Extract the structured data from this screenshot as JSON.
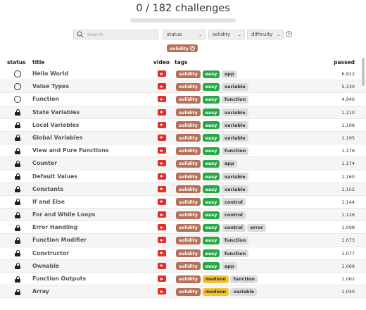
{
  "header": {
    "progress_text": "0 / 182 challenges",
    "progress_fraction": 0
  },
  "filters": {
    "search_placeholder": "Search",
    "status_label": "status",
    "solidity_label": "solidity",
    "difficulty_label": "difficulty",
    "active_filter": "solidity"
  },
  "table": {
    "columns": {
      "status": "status",
      "title": "title",
      "video": "video",
      "tags": "tags",
      "passed": "passed"
    },
    "rows": [
      {
        "status": "circle-icon",
        "title": "Hello World",
        "tags": [
          "solidity",
          "easy",
          "app"
        ],
        "passed": "6,912"
      },
      {
        "status": "circle-icon",
        "title": "Value Types",
        "tags": [
          "solidity",
          "easy",
          "variable"
        ],
        "passed": "5,330"
      },
      {
        "status": "circle-icon",
        "title": "Function",
        "tags": [
          "solidity",
          "easy",
          "function"
        ],
        "passed": "4,946"
      },
      {
        "status": "lock-icon",
        "title": "State Variables",
        "tags": [
          "solidity",
          "easy",
          "variable"
        ],
        "passed": "1,210"
      },
      {
        "status": "lock-icon",
        "title": "Local Variables",
        "tags": [
          "solidity",
          "easy",
          "variable"
        ],
        "passed": "1,198"
      },
      {
        "status": "lock-icon",
        "title": "Global Variables",
        "tags": [
          "solidity",
          "easy",
          "variable"
        ],
        "passed": "1,195"
      },
      {
        "status": "lock-icon",
        "title": "View and Pure Functions",
        "tags": [
          "solidity",
          "easy",
          "function"
        ],
        "passed": "1,176"
      },
      {
        "status": "lock-icon",
        "title": "Counter",
        "tags": [
          "solidity",
          "easy",
          "app"
        ],
        "passed": "1,174"
      },
      {
        "status": "lock-icon",
        "title": "Default Values",
        "tags": [
          "solidity",
          "easy",
          "variable"
        ],
        "passed": "1,160"
      },
      {
        "status": "lock-icon",
        "title": "Constants",
        "tags": [
          "solidity",
          "easy",
          "variable"
        ],
        "passed": "1,152"
      },
      {
        "status": "lock-icon",
        "title": "If and Else",
        "tags": [
          "solidity",
          "easy",
          "control"
        ],
        "passed": "1,144"
      },
      {
        "status": "lock-icon",
        "title": "For and While Loops",
        "tags": [
          "solidity",
          "easy",
          "control"
        ],
        "passed": "1,126"
      },
      {
        "status": "lock-icon",
        "title": "Error Handling",
        "tags": [
          "solidity",
          "easy",
          "control",
          "error"
        ],
        "passed": "1,098"
      },
      {
        "status": "lock-icon",
        "title": "Function Modifier",
        "tags": [
          "solidity",
          "easy",
          "function"
        ],
        "passed": "1,073"
      },
      {
        "status": "lock-icon",
        "title": "Constructor",
        "tags": [
          "solidity",
          "easy",
          "function"
        ],
        "passed": "1,077"
      },
      {
        "status": "lock-icon",
        "title": "Ownable",
        "tags": [
          "solidity",
          "easy",
          "app"
        ],
        "passed": "1,069"
      },
      {
        "status": "lock-icon",
        "title": "Function Outputs",
        "tags": [
          "solidity",
          "medium",
          "function"
        ],
        "passed": "1,061"
      },
      {
        "status": "lock-icon",
        "title": "Array",
        "tags": [
          "solidity",
          "medium",
          "variable"
        ],
        "passed": "1,040"
      }
    ]
  },
  "colors": {
    "solidity": "#b5705a",
    "easy": "#27a844",
    "medium": "#f2c230",
    "topic": "#dcdcdc",
    "video": "#e52d27"
  }
}
